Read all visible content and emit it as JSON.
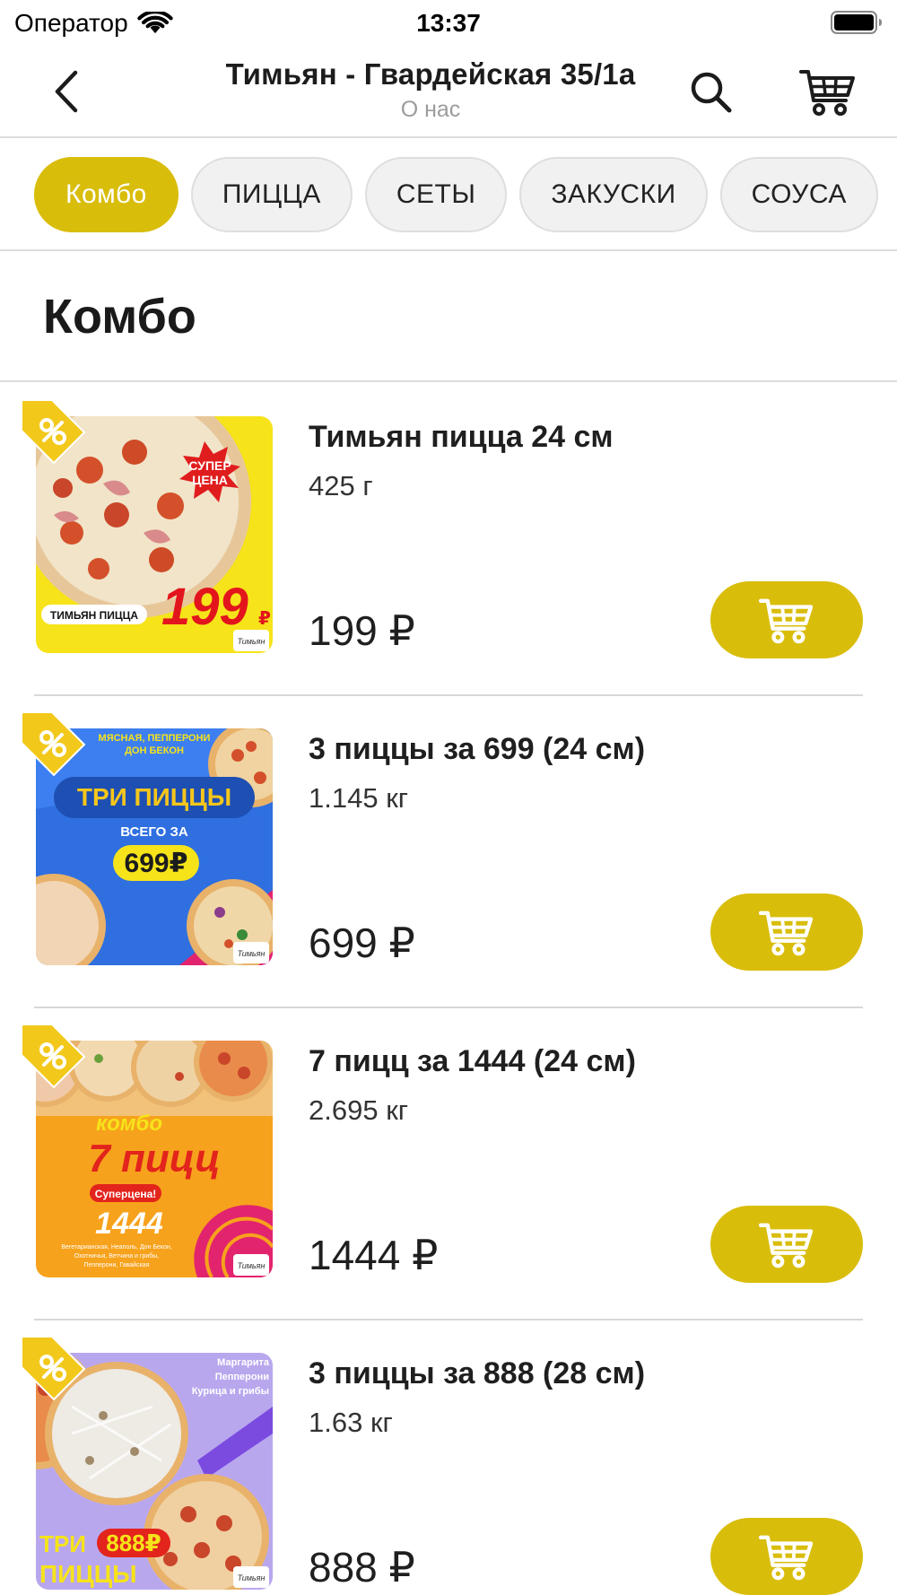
{
  "status_bar": {
    "carrier": "Оператор",
    "time": "13:37"
  },
  "nav": {
    "title": "Тимьян - Гвардейская 35/1а",
    "subtitle": "О нас"
  },
  "categories": [
    {
      "label": "Комбо",
      "active": true
    },
    {
      "label": "ПИЦЦА",
      "active": false
    },
    {
      "label": "СЕТЫ",
      "active": false
    },
    {
      "label": "ЗАКУСКИ",
      "active": false
    },
    {
      "label": "СОУСА",
      "active": false
    }
  ],
  "section": {
    "title": "Комбо"
  },
  "products": [
    {
      "name": "Тимьян пицца 24 см",
      "weight": "425 г",
      "price": "199 ₽",
      "image": {
        "bg": "#f6e31a",
        "label": "ТИМЬЯН ПИЦЦА",
        "big_price": "199",
        "currency": "₽",
        "burst_line1": "СУПЕР",
        "burst_line2": "ЦЕНА",
        "logo": "Тимьян"
      }
    },
    {
      "name": "3 пиццы за 699 (24 см)",
      "weight": "1.145 кг",
      "price": "699 ₽",
      "image": {
        "bg": "#2f6fe0",
        "top_line1": "МЯСНАЯ, ПЕППЕРОНИ",
        "top_line2": "ДОН БЕКОН",
        "banner": "ТРИ ПИЦЦЫ",
        "sub": "ВСЕГО ЗА",
        "big_price": "699₽",
        "logo": "Тимьян"
      }
    },
    {
      "name": "7 пицц за 1444 (24 см)",
      "weight": "2.695 кг",
      "price": "1444 ₽",
      "image": {
        "bg": "#f7a21c",
        "line1": "комбо",
        "line2": "7 пицц",
        "tag": "Суперцена!",
        "big_price": "1444",
        "small1": "Вегетарианская, Неаполь, Дон Бекон,",
        "small2": "Охотничья, Ветчина и грибы,",
        "small3": "Пепперони, Гавайская",
        "logo": "Тимьян"
      }
    },
    {
      "name": "3 пиццы за 888 (28 см)",
      "weight": "1.63 кг",
      "price": "888 ₽",
      "image": {
        "bg": "#b9a7ee",
        "right_line1": "Маргарита",
        "right_line2": "Пепперони",
        "right_line3": "Курица и грибы",
        "bottom_word1": "ТРИ",
        "badge_price": "888₽",
        "bottom_word2": "ПИЦЦЫ",
        "logo": "Тимьян"
      }
    }
  ],
  "colors": {
    "accent": "#d9bd0b",
    "chip_bg": "#f1f1f1",
    "divider": "#dcdcdc",
    "subtitle": "#9c9c9c",
    "badge": "#f2c81b"
  },
  "icons": {
    "back": "chevron-left-icon",
    "search": "search-icon",
    "cart": "cart-icon",
    "add_to_cart": "cart-icon",
    "discount": "percent-tag-icon",
    "signal": "wifi-icon",
    "battery": "battery-icon"
  }
}
